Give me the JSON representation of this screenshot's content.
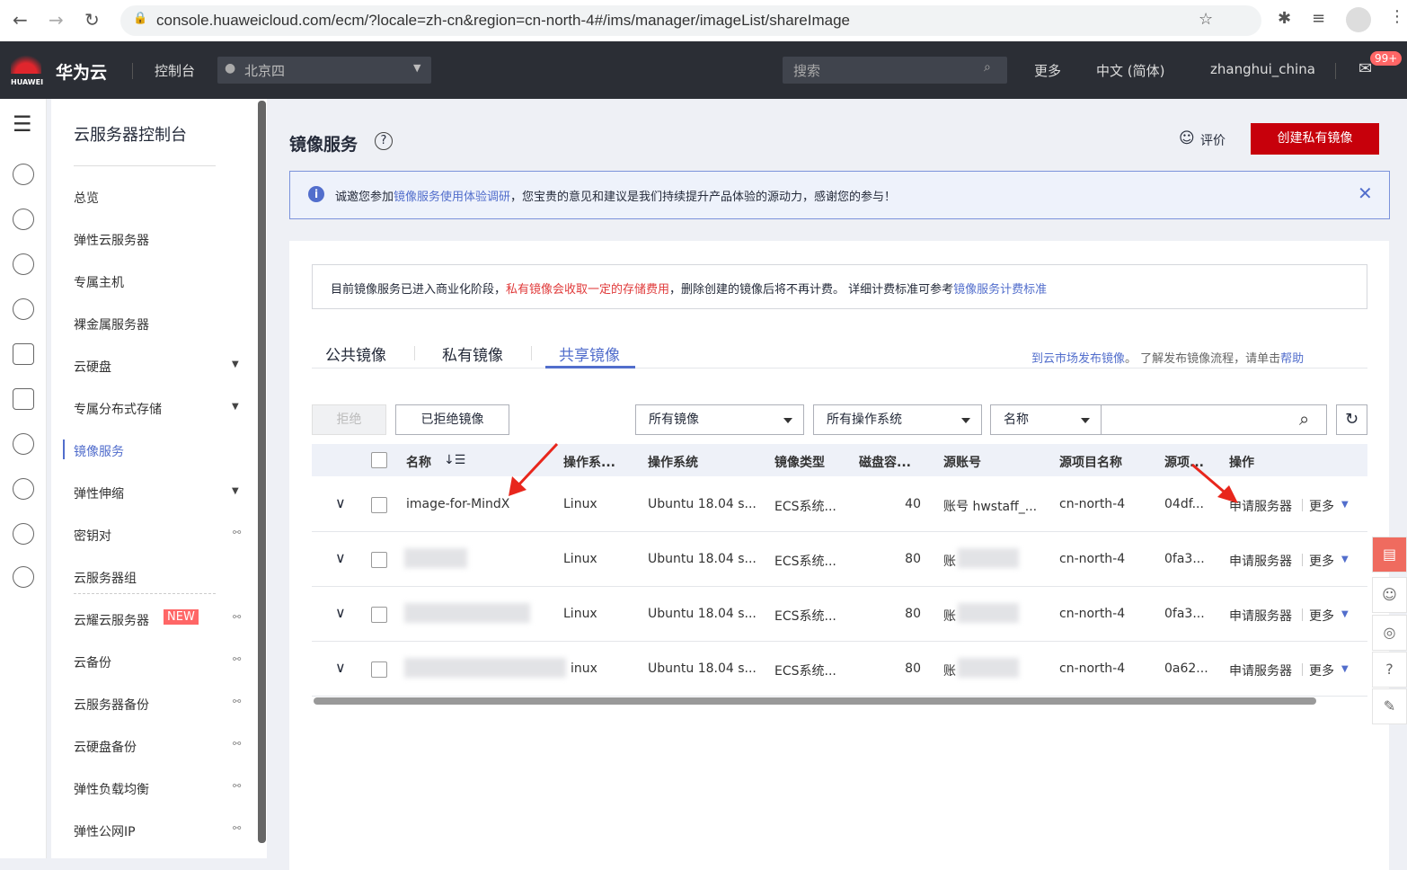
{
  "browser": {
    "url": "console.huaweicloud.com/ecm/?locale=zh-cn&region=cn-north-4#/ims/manager/imageList/shareImage"
  },
  "header": {
    "logo_text": "HUAWEI",
    "brand": "华为云",
    "console": "控制台",
    "region": "北京四",
    "search_placeholder": "搜索",
    "more": "更多",
    "lang": "中文 (简体)",
    "user": "zhanghui_china",
    "badge": "99+"
  },
  "sidebar": {
    "title": "云服务器控制台",
    "items": [
      {
        "label": "总览"
      },
      {
        "label": "弹性云服务器"
      },
      {
        "label": "专属主机"
      },
      {
        "label": "裸金属服务器"
      },
      {
        "label": "云硬盘",
        "caret": true
      },
      {
        "label": "专属分布式存储",
        "caret": true
      },
      {
        "label": "镜像服务",
        "active": true
      },
      {
        "label": "弹性伸缩",
        "caret": true
      },
      {
        "label": "密钥对",
        "ext": true
      },
      {
        "label": "云服务器组"
      },
      {
        "label": "云耀云服务器",
        "badge": "NEW",
        "ext": true
      },
      {
        "label": "云备份",
        "ext": true
      },
      {
        "label": "云服务器备份",
        "ext": true
      },
      {
        "label": "云硬盘备份",
        "ext": true
      },
      {
        "label": "弹性负载均衡",
        "ext": true
      },
      {
        "label": "弹性公网IP",
        "ext": true
      }
    ]
  },
  "page": {
    "title": "镜像服务",
    "rate": "评价",
    "create": "创建私有镜像"
  },
  "banner": {
    "pre": "诚邀您参加",
    "link": "镜像服务使用体验调研",
    "post": "，您宝贵的意见和建议是我们持续提升产品体验的源动力，感谢您的参与！"
  },
  "notice": {
    "p1": "目前镜像服务已进入商业化阶段，",
    "p2": "私有镜像会收取一定的存储费用",
    "p3": "，删除创建的镜像后将不再计费。 详细计费标准可参考",
    "p4": "镜像服务计费标准"
  },
  "tabs": [
    {
      "label": "公共镜像"
    },
    {
      "label": "私有镜像"
    },
    {
      "label": "共享镜像",
      "active": true
    }
  ],
  "tabs_right": {
    "link1": "到云市场发布镜像",
    "mid": "。 了解发布镜像流程，请单击",
    "link2": "帮助"
  },
  "toolbar": {
    "reject": "拒绝",
    "rejected": "已拒绝镜像",
    "filter1": "所有镜像",
    "filter2": "所有操作系统",
    "filter3": "名称"
  },
  "table": {
    "headers": [
      "名称",
      "操作系...",
      "操作系统",
      "镜像类型",
      "磁盘容...",
      "源账号",
      "源项目名称",
      "源项...",
      "操作"
    ],
    "rows": [
      {
        "name": "image-for-MindX",
        "os": "Linux",
        "osname": "Ubuntu 18.04 s...",
        "type": "ECS系统...",
        "disk": "40",
        "account": "账号 hwstaff_...",
        "project": "cn-north-4",
        "pid": "04df...",
        "apply": "申请服务器",
        "more": "更多"
      },
      {
        "name": "",
        "os": "Linux",
        "osname": "Ubuntu 18.04 s...",
        "type": "ECS系统...",
        "disk": "80",
        "account": "账",
        "project": "cn-north-4",
        "pid": "0fa3...",
        "apply": "申请服务器",
        "more": "更多"
      },
      {
        "name": "",
        "os": "Linux",
        "osname": "Ubuntu 18.04 s...",
        "type": "ECS系统...",
        "disk": "80",
        "account": "账",
        "project": "cn-north-4",
        "pid": "0fa3...",
        "apply": "申请服务器",
        "more": "更多"
      },
      {
        "name": "",
        "os": "inux",
        "osname": "Ubuntu 18.04 s...",
        "type": "ECS系统...",
        "disk": "80",
        "account": "账",
        "project": "cn-north-4",
        "pid": "0a62...",
        "apply": "申请服务器",
        "more": "更多"
      }
    ]
  },
  "colors": {
    "accent": "#526ecc",
    "primary_button": "#c7000b",
    "header_bg": "#2b2e35",
    "annotation": "#e8261c"
  }
}
